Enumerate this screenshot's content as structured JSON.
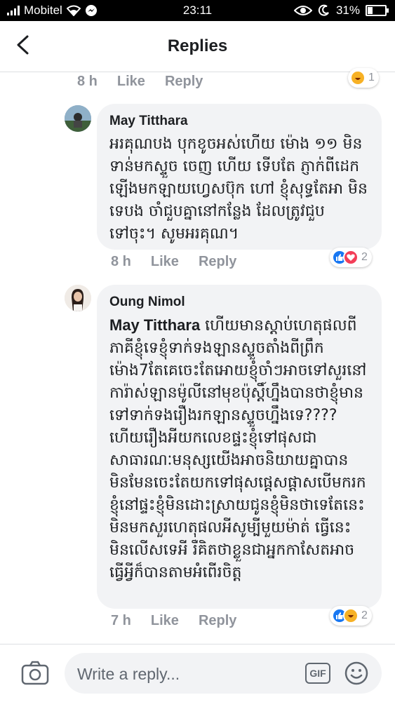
{
  "status": {
    "carrier": "Mobitel",
    "time": "23:11",
    "battery": "31%",
    "battery_level": 0.31
  },
  "header": {
    "title": "Replies"
  },
  "top_partial": {
    "time": "8 h",
    "like": "Like",
    "reply": "Reply",
    "reaction_count": "1"
  },
  "comments": [
    {
      "author": "May Titthara",
      "text": "អរគុណបង បុកខូចអស់ហើយ ម៉ោង ១១ មិនទាន់មកស្ទួច ចេញ ហើយ ទើបតែ ភ្ញាក់ពីដេកឡើងមកឡាយហ្វេសប៊ុក ហៅ ខ្ញុំសុទ្ធតែអា មិនទេបង ចាំជួបគ្នានៅកន្លែង ដែលត្រូវជួបទៅចុះ។ សូមអរគុណ។",
      "time": "8 h",
      "like": "Like",
      "reply": "Reply",
      "reaction_count": "2"
    },
    {
      "author": "Oung Nimol",
      "mention": "May Titthara",
      "text": " ហើយមានស្តាប់ហេតុផលពីភាគីខ្ញុំទេខ្ញុំទាក់ទងឡានស្ទួចតាំងពីព្រឹកម៉ោង7តែគេចេះតែអោយខ្ញុំចាំៗអាចទៅសួរនៅការ៉ាស់ឡានម៉ូលីនៅមុខប៉ុស្ដិ៍ហ្នឹងបានថាខ្ញុំមានទៅទាក់ទងរឿងរកឡានស្ទួចហ្នឹងទេ????ហើយរឿងអីយកលេខផ្ទះខ្ញុំទៅផុសជាសាធារណៈមនុស្សយើងអាចនិយាយគ្នាបានមិនមែនចេះតែយកទៅផុសផ្ដេសផ្ដាសបើមករកខ្ញុំនៅផ្ទះខ្ញុំមិនដោះស្រាយជូនខ្ញុំមិនថាទេតែនេះមិនមកសួរហេតុផលអីសូម្បីមួយម៉ាត់ ធ្វើនេះមិនលើសទេអី រឺគិតថាខ្លួនជាអ្នកកាសែតអាចធ្វើអ្វីក៏បានតាមអំពើរចិត្ត",
      "time": "7 h",
      "like": "Like",
      "reply": "Reply",
      "reaction_count": "2"
    }
  ],
  "composer": {
    "placeholder": "Write a reply...",
    "gif_label": "GIF"
  },
  "colors": {
    "bubble": "#f2f3f5",
    "meta": "#90949c",
    "like_blue": "#1877f2",
    "love_red": "#f33e58",
    "haha_yellow": "#f7b125"
  }
}
